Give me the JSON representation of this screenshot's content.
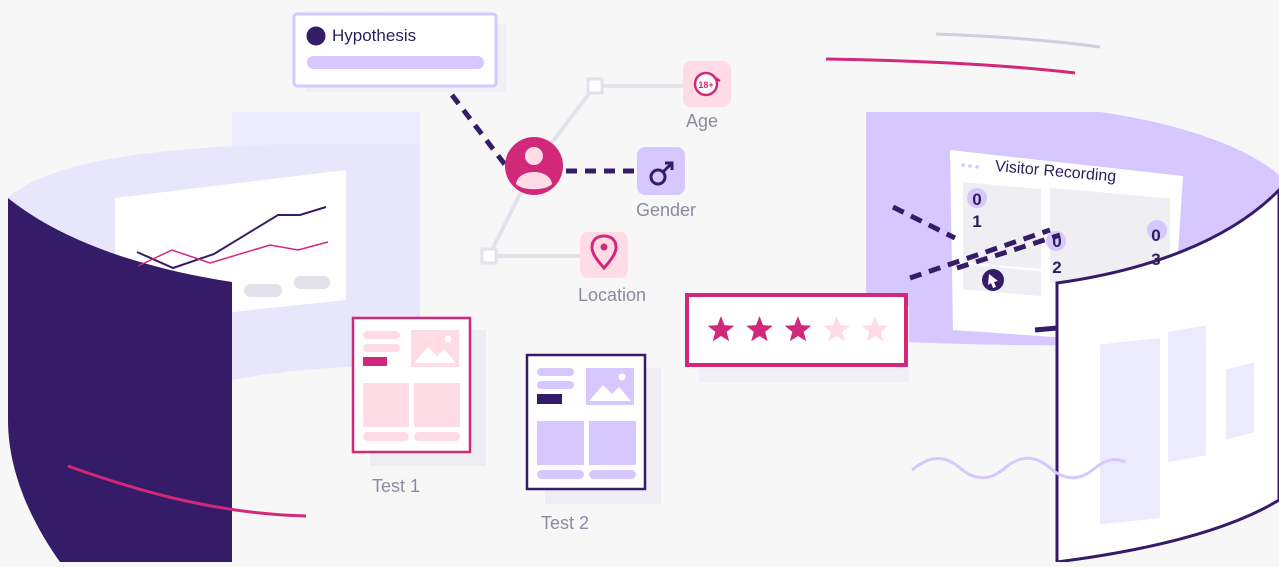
{
  "hypothesis": {
    "label": "Hypothesis"
  },
  "attributes": {
    "age": {
      "label": "Age",
      "badge": "18+"
    },
    "gender": {
      "label": "Gender",
      "icon": "male-symbol-icon"
    },
    "location": {
      "label": "Location",
      "icon": "location-pin-icon"
    }
  },
  "tests": [
    {
      "label": "Test 1"
    },
    {
      "label": "Test 2"
    }
  ],
  "visitor_recording": {
    "title": "Visitor Recording",
    "cells": [
      {
        "top": "0",
        "bottom": "1"
      },
      {
        "top": "0",
        "bottom": "2"
      },
      {
        "top": "0",
        "bottom": "3"
      }
    ]
  },
  "rating": {
    "value": 3,
    "max": 5
  },
  "colors": {
    "accent": "#d2287a",
    "dark_purple": "#351c68",
    "light_purple": "#d6c8ff",
    "pale_lavender": "#eceafd",
    "pink_light": "#ffdbe6"
  }
}
